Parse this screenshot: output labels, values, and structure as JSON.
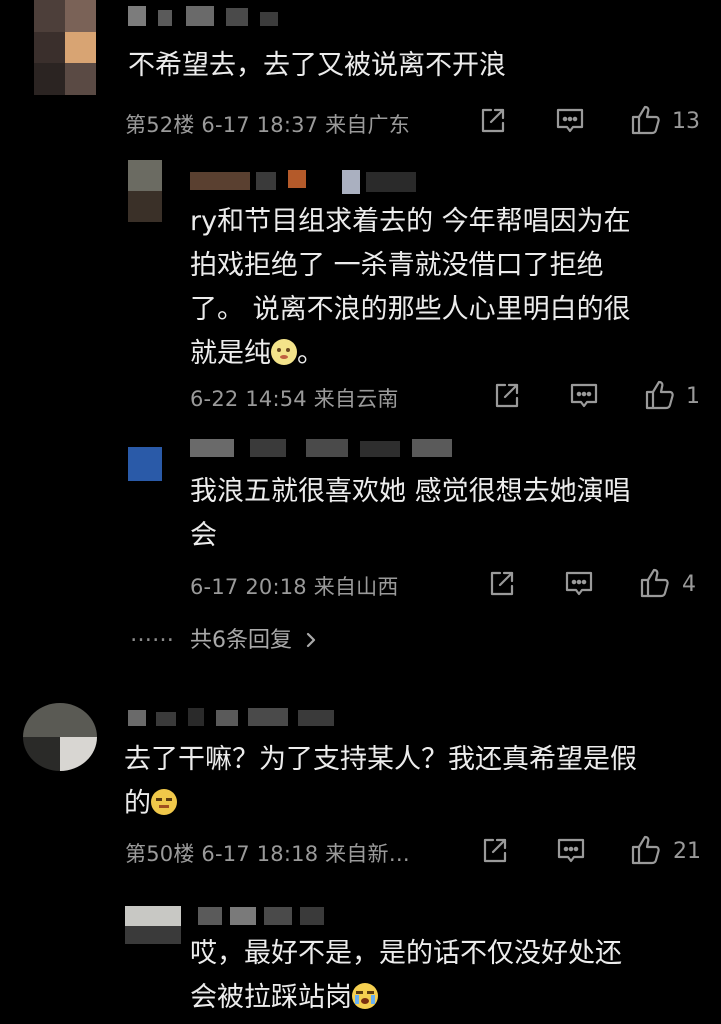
{
  "comments": [
    {
      "text": "不希望去，去了又被说离不开浪",
      "meta": "第52楼  6-17 18:37  来自广东",
      "likes": "13"
    }
  ],
  "replies": [
    {
      "text_lines": [
        "ry和节目组求着去的 今年帮唱因为在",
        "拍戏拒绝了 一杀青就没借口了拒绝",
        "了。 说离不浪的那些人心里明白的很",
        "就是纯"
      ],
      "text_tail": "。",
      "meta": "6-22 14:54  来自云南",
      "likes": "1"
    },
    {
      "text_lines": [
        "我浪五就很喜欢她 感觉很想去她演唱",
        "会"
      ],
      "meta": "6-17 20:18  来自山西",
      "likes": "4"
    }
  ],
  "more_dots": "……",
  "more_replies": "共6条回复",
  "comment2": {
    "text_lines": [
      "去了干嘛？为了支持某人？我还真希望是假",
      "的"
    ],
    "meta": "第50楼  6-17 18:18  来自新…",
    "likes": "21"
  },
  "reply3": {
    "text_lines": [
      "哎，最好不是，是的话不仅没好处还",
      "会被拉踩站岗"
    ]
  },
  "icons": {
    "share": "share-icon",
    "comment": "comment-icon",
    "like": "thumbs-up-icon",
    "chevron": "chevron-right-icon"
  },
  "colors": {
    "background": "#000000",
    "text": "#ececec",
    "meta": "#9a9a9a"
  }
}
